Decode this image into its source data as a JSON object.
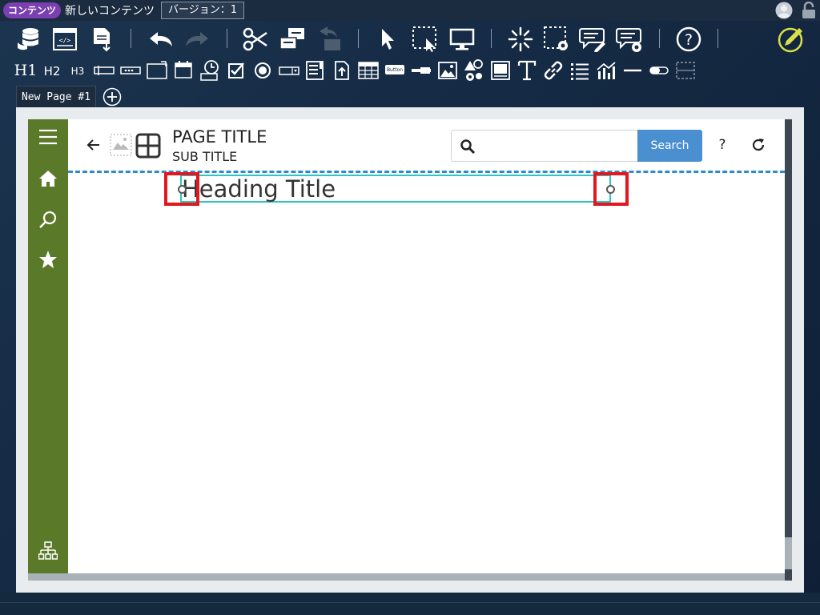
{
  "titlebar": {
    "badge": "コンテンツ",
    "content_name": "新しいコンテンツ",
    "version": "バージョン：1"
  },
  "toolbar1": {
    "icons": [
      "database-icon",
      "code-view-icon",
      "export-icon",
      "undo-icon",
      "redo-icon",
      "cut-icon",
      "copy-icon",
      "paste-icon",
      "select-icon",
      "region-select-icon",
      "preview-icon",
      "spinner-icon",
      "area-settings-icon",
      "edit-comment-icon",
      "comment-settings-icon",
      "help-icon",
      "edit-pencil-icon"
    ]
  },
  "toolbar2": {
    "h1": "H1",
    "h2": "H2",
    "h3": "H3",
    "button_widget": "Button"
  },
  "tabs": [
    {
      "label": "New Page #1"
    }
  ],
  "page": {
    "title": "PAGE TITLE",
    "subtitle": "SUB TITLE",
    "search_placeholder": "",
    "search_button": "Search",
    "help": "?",
    "heading": "Heading Title"
  },
  "colors": {
    "leftnav": "#5a7a2a",
    "accent_blue": "#4a8fd0",
    "selection_teal": "#2ec4c4",
    "marker_red": "#e2171f",
    "badge_purple": "#7a3fb0"
  }
}
